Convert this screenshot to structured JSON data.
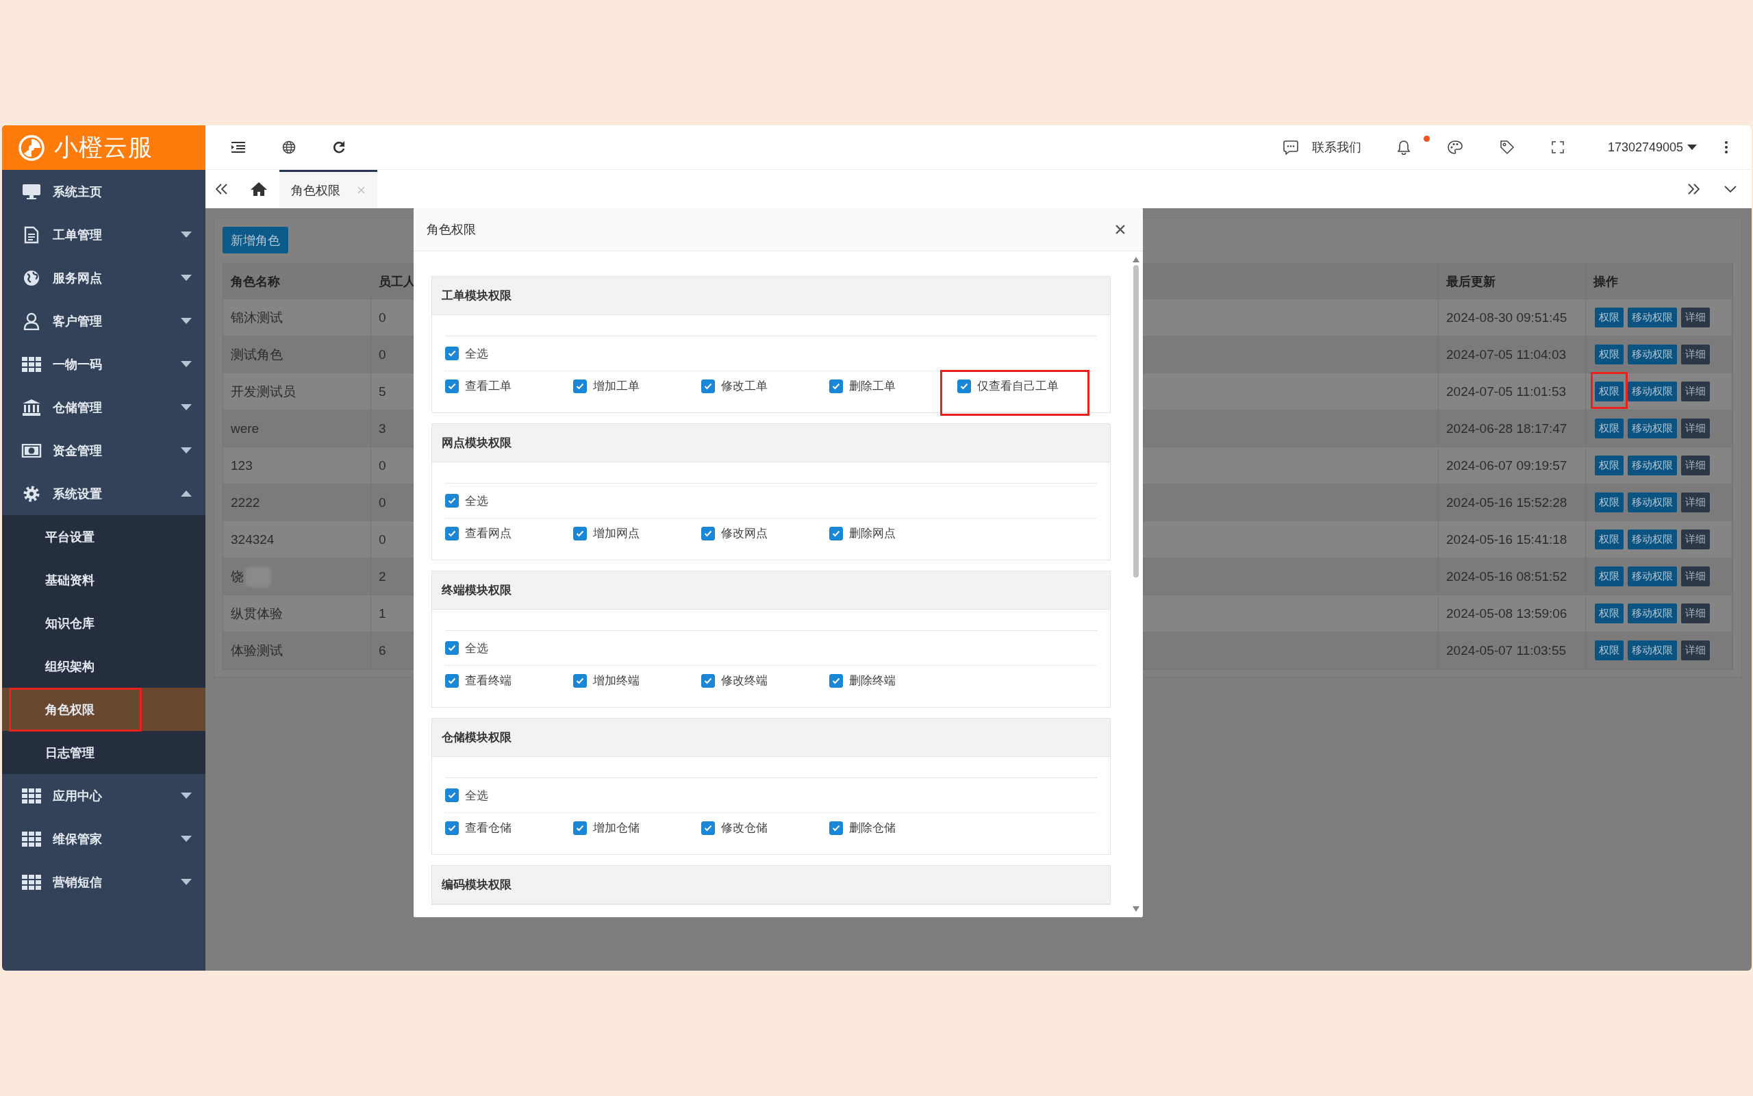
{
  "logo": {
    "text": "小橙云服"
  },
  "sidebar": {
    "items": [
      {
        "label": "系统主页",
        "kind": "link"
      },
      {
        "label": "工单管理",
        "kind": "menu",
        "expanded": false
      },
      {
        "label": "服务网点",
        "kind": "menu",
        "expanded": false
      },
      {
        "label": "客户管理",
        "kind": "menu",
        "expanded": false
      },
      {
        "label": "一物一码",
        "kind": "menu",
        "expanded": false
      },
      {
        "label": "仓储管理",
        "kind": "menu",
        "expanded": false
      },
      {
        "label": "资金管理",
        "kind": "menu",
        "expanded": false
      },
      {
        "label": "系统设置",
        "kind": "menu",
        "expanded": true,
        "children": [
          {
            "label": "平台设置",
            "selected": false,
            "highlighted": false
          },
          {
            "label": "基础资料",
            "selected": false,
            "highlighted": false
          },
          {
            "label": "知识仓库",
            "selected": false,
            "highlighted": false
          },
          {
            "label": "组织架构",
            "selected": false,
            "highlighted": false
          },
          {
            "label": "角色权限",
            "selected": true,
            "highlighted": true
          },
          {
            "label": "日志管理",
            "selected": false,
            "highlighted": false
          }
        ]
      },
      {
        "label": "应用中心",
        "kind": "menu",
        "expanded": false
      },
      {
        "label": "维保管家",
        "kind": "menu",
        "expanded": false
      },
      {
        "label": "营销短信",
        "kind": "menu",
        "expanded": false
      }
    ]
  },
  "header": {
    "contact": "联系我们",
    "notification_unread": true,
    "user": "17302749005"
  },
  "tabs": [
    {
      "label": "角色权限",
      "selected": true
    }
  ],
  "content": {
    "add_button": "新增角色",
    "table": {
      "columns": [
        {
          "label": "角色名称"
        },
        {
          "label": "员工人"
        },
        {
          "label": "最后更新"
        },
        {
          "label": "操作"
        }
      ],
      "rows": [
        {
          "name": "锦沐测试",
          "staff": "0",
          "updated": "2024-08-30 09:51:45",
          "redacted": false,
          "actions": [
            {
              "label": "权限",
              "kind": "primary",
              "highlighted": false
            },
            {
              "label": "移动权限",
              "kind": "primary",
              "highlighted": false
            },
            {
              "label": "详细",
              "kind": "dark",
              "highlighted": false
            }
          ]
        },
        {
          "name": "测试角色",
          "staff": "0",
          "updated": "2024-07-05 11:04:03",
          "redacted": false,
          "actions": [
            {
              "label": "权限",
              "kind": "primary",
              "highlighted": false
            },
            {
              "label": "移动权限",
              "kind": "primary",
              "highlighted": false
            },
            {
              "label": "详细",
              "kind": "dark",
              "highlighted": false
            }
          ]
        },
        {
          "name": "开发测试员",
          "staff": "5",
          "updated": "2024-07-05 11:01:53",
          "redacted": false,
          "actions": [
            {
              "label": "权限",
              "kind": "primary",
              "highlighted": true
            },
            {
              "label": "移动权限",
              "kind": "primary",
              "highlighted": false
            },
            {
              "label": "详细",
              "kind": "dark",
              "highlighted": false
            }
          ]
        },
        {
          "name": "were",
          "staff": "3",
          "updated": "2024-06-28 18:17:47",
          "redacted": false,
          "actions": [
            {
              "label": "权限",
              "kind": "primary",
              "highlighted": false
            },
            {
              "label": "移动权限",
              "kind": "primary",
              "highlighted": false
            },
            {
              "label": "详细",
              "kind": "dark",
              "highlighted": false
            }
          ]
        },
        {
          "name": "123",
          "staff": "0",
          "updated": "2024-06-07 09:19:57",
          "redacted": false,
          "actions": [
            {
              "label": "权限",
              "kind": "primary",
              "highlighted": false
            },
            {
              "label": "移动权限",
              "kind": "primary",
              "highlighted": false
            },
            {
              "label": "详细",
              "kind": "dark",
              "highlighted": false
            }
          ]
        },
        {
          "name": "2222",
          "staff": "0",
          "updated": "2024-05-16 15:52:28",
          "redacted": false,
          "actions": [
            {
              "label": "权限",
              "kind": "primary",
              "highlighted": false
            },
            {
              "label": "移动权限",
              "kind": "primary",
              "highlighted": false
            },
            {
              "label": "详细",
              "kind": "dark",
              "highlighted": false
            }
          ]
        },
        {
          "name": "324324",
          "staff": "0",
          "updated": "2024-05-16 15:41:18",
          "redacted": false,
          "actions": [
            {
              "label": "权限",
              "kind": "primary",
              "highlighted": false
            },
            {
              "label": "移动权限",
              "kind": "primary",
              "highlighted": false
            },
            {
              "label": "详细",
              "kind": "dark",
              "highlighted": false
            }
          ]
        },
        {
          "name": "饶",
          "staff": "2",
          "updated": "2024-05-16 08:51:52",
          "redacted": true,
          "actions": [
            {
              "label": "权限",
              "kind": "primary",
              "highlighted": false
            },
            {
              "label": "移动权限",
              "kind": "primary",
              "highlighted": false
            },
            {
              "label": "详细",
              "kind": "dark",
              "highlighted": false
            }
          ]
        },
        {
          "name": "纵贯体验",
          "staff": "1",
          "updated": "2024-05-08 13:59:06",
          "redacted": false,
          "actions": [
            {
              "label": "权限",
              "kind": "primary",
              "highlighted": false
            },
            {
              "label": "移动权限",
              "kind": "primary",
              "highlighted": false
            },
            {
              "label": "详细",
              "kind": "dark",
              "highlighted": false
            }
          ]
        },
        {
          "name": "体验测试",
          "staff": "6",
          "updated": "2024-05-07 11:03:55",
          "redacted": false,
          "actions": [
            {
              "label": "权限",
              "kind": "primary",
              "highlighted": false
            },
            {
              "label": "移动权限",
              "kind": "primary",
              "highlighted": false
            },
            {
              "label": "详细",
              "kind": "dark",
              "highlighted": false
            }
          ]
        }
      ]
    }
  },
  "modal": {
    "title": "角色权限",
    "sections": [
      {
        "title": "工单模块权限",
        "select_all": {
          "label": "全选",
          "checked": true
        },
        "permissions": [
          {
            "label": "查看工单",
            "checked": true,
            "highlighted": false
          },
          {
            "label": "增加工单",
            "checked": true,
            "highlighted": false
          },
          {
            "label": "修改工单",
            "checked": true,
            "highlighted": false
          },
          {
            "label": "删除工单",
            "checked": true,
            "highlighted": false
          },
          {
            "label": "仅查看自己工单",
            "checked": true,
            "highlighted": true
          }
        ]
      },
      {
        "title": "网点模块权限",
        "select_all": {
          "label": "全选",
          "checked": true
        },
        "permissions": [
          {
            "label": "查看网点",
            "checked": true,
            "highlighted": false
          },
          {
            "label": "增加网点",
            "checked": true,
            "highlighted": false
          },
          {
            "label": "修改网点",
            "checked": true,
            "highlighted": false
          },
          {
            "label": "删除网点",
            "checked": true,
            "highlighted": false
          }
        ]
      },
      {
        "title": "终端模块权限",
        "select_all": {
          "label": "全选",
          "checked": true
        },
        "permissions": [
          {
            "label": "查看终端",
            "checked": true,
            "highlighted": false
          },
          {
            "label": "增加终端",
            "checked": true,
            "highlighted": false
          },
          {
            "label": "修改终端",
            "checked": true,
            "highlighted": false
          },
          {
            "label": "删除终端",
            "checked": true,
            "highlighted": false
          }
        ]
      },
      {
        "title": "仓储模块权限",
        "select_all": {
          "label": "全选",
          "checked": true
        },
        "permissions": [
          {
            "label": "查看仓储",
            "checked": true,
            "highlighted": false
          },
          {
            "label": "增加仓储",
            "checked": true,
            "highlighted": false
          },
          {
            "label": "修改仓储",
            "checked": true,
            "highlighted": false
          },
          {
            "label": "删除仓储",
            "checked": true,
            "highlighted": false
          }
        ]
      },
      {
        "title": "编码模块权限"
      }
    ]
  }
}
